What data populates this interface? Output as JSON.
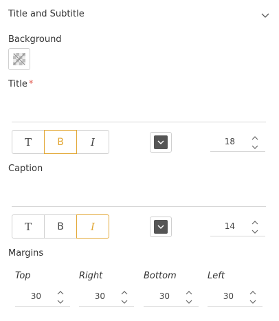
{
  "section": {
    "title": "Title and Subtitle",
    "icon": "chevron-down-icon"
  },
  "background": {
    "label": "Background",
    "icon": "transparent-swatch-icon"
  },
  "title_field": {
    "label": "Title",
    "required_mark": "*",
    "value": "",
    "styles": [
      {
        "label": "T",
        "name": "plain",
        "active": false
      },
      {
        "label": "B",
        "name": "bold",
        "active": true
      },
      {
        "label": "I",
        "name": "italic",
        "active": false
      }
    ],
    "color": "#555555",
    "font_size": "18"
  },
  "caption_field": {
    "label": "Caption",
    "value": "",
    "styles": [
      {
        "label": "T",
        "name": "plain",
        "active": false
      },
      {
        "label": "B",
        "name": "bold",
        "active": false
      },
      {
        "label": "I",
        "name": "italic",
        "active": true
      }
    ],
    "color": "#555555",
    "font_size": "14"
  },
  "margins": {
    "label": "Margins",
    "top": {
      "label": "Top",
      "value": "30"
    },
    "right": {
      "label": "Right",
      "value": "30"
    },
    "bottom": {
      "label": "Bottom",
      "value": "30"
    },
    "left": {
      "label": "Left",
      "value": "30"
    }
  },
  "colors": {
    "accent": "#e2a735",
    "required": "#e05a4f",
    "border": "#d0d0d0"
  }
}
